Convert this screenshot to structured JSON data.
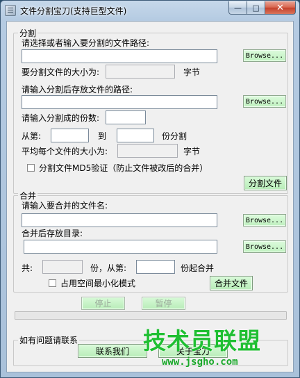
{
  "window": {
    "title": "文件分割宝刀(支持巨型文件)",
    "close_glyph": "✕",
    "min_glyph": "—",
    "max_glyph": "□"
  },
  "split": {
    "group_label": "分割",
    "path_label": "请选择或者输入要分割的文件路径:",
    "path_value": "",
    "browse_label": "Browse...",
    "size_label": "要分割文件的大小为:",
    "size_value": "",
    "size_unit": "字节",
    "out_label": "请输入分割后存放文件的路径:",
    "out_value": "",
    "parts_label": "请输入分割成的份数:",
    "parts_value": "",
    "from_label": "从第:",
    "from_value": "",
    "to_label": "到",
    "to_value": "",
    "to_suffix": "份分割",
    "avg_label": "平均每个文件的大小为:",
    "avg_value": "",
    "avg_unit": "字节",
    "md5_label": "分割文件MD5验证（防止文件被改后的合并）",
    "md5_checked": false,
    "split_button": "分割文件"
  },
  "merge": {
    "group_label": "合并",
    "file_label": "请输入要合并的文件名:",
    "file_value": "",
    "browse_label": "Browse...",
    "dir_label": "合并后存放目录:",
    "dir_value": "",
    "total_label": "共:",
    "total_value": "",
    "total_suffix": "份，从第:",
    "start_value": "",
    "start_suffix": "份起合并",
    "minspace_label": "占用空间最小化模式",
    "minspace_checked": false,
    "merge_button": "合并文件"
  },
  "controls": {
    "stop_button": "停止",
    "pause_button": "暂停",
    "progress_percent": 0
  },
  "contact": {
    "group_label": "如有问题请联系",
    "contact_button": "联系我们",
    "about_button": "关于宝刀"
  },
  "watermark": {
    "main_text": "技术员联盟",
    "url_text": "www.jsgho.com"
  }
}
